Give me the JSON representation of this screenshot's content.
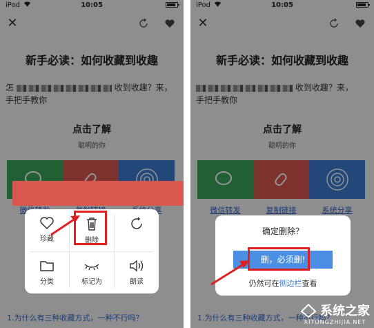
{
  "status_bar": {
    "carrier": "iPod",
    "time": "10:05"
  },
  "article": {
    "title": "新手必读：如何收藏到收趣",
    "para_start": "怎",
    "para_mid": "收到收趣？来，",
    "para_line2": "手把手教你",
    "subhead": "点击了解",
    "subtext": "聪明的你"
  },
  "tiles": {
    "labels": [
      "微信转发",
      "复制链接",
      "系统分享"
    ]
  },
  "menu": {
    "items": [
      {
        "label": "珍藏",
        "icon": "heart-icon"
      },
      {
        "label": "删除",
        "icon": "trash-icon"
      },
      {
        "label": "",
        "icon": "share-icon"
      },
      {
        "label": "分类",
        "icon": "folder-icon"
      },
      {
        "label": "标记为",
        "icon": "eye-closed-icon"
      },
      {
        "label": "朗读",
        "icon": "speaker-icon"
      }
    ]
  },
  "dialog": {
    "title": "确定删除？",
    "confirm_button": "删，必须删!",
    "note_prefix": "仍然可在",
    "note_link": "侧边栏",
    "note_suffix": "查看"
  },
  "footer": {
    "question": "1.为什么有三种收藏方式，一种不行吗？"
  },
  "watermark": {
    "text": "系统之家",
    "url": "XITONGZHIJIA.NET"
  },
  "colors": {
    "highlight": "#e02020",
    "tile_green": "#3aa65a",
    "tile_red": "#d9574f",
    "tile_blue": "#3b7dd1",
    "button_blue": "#4a8fe3"
  }
}
